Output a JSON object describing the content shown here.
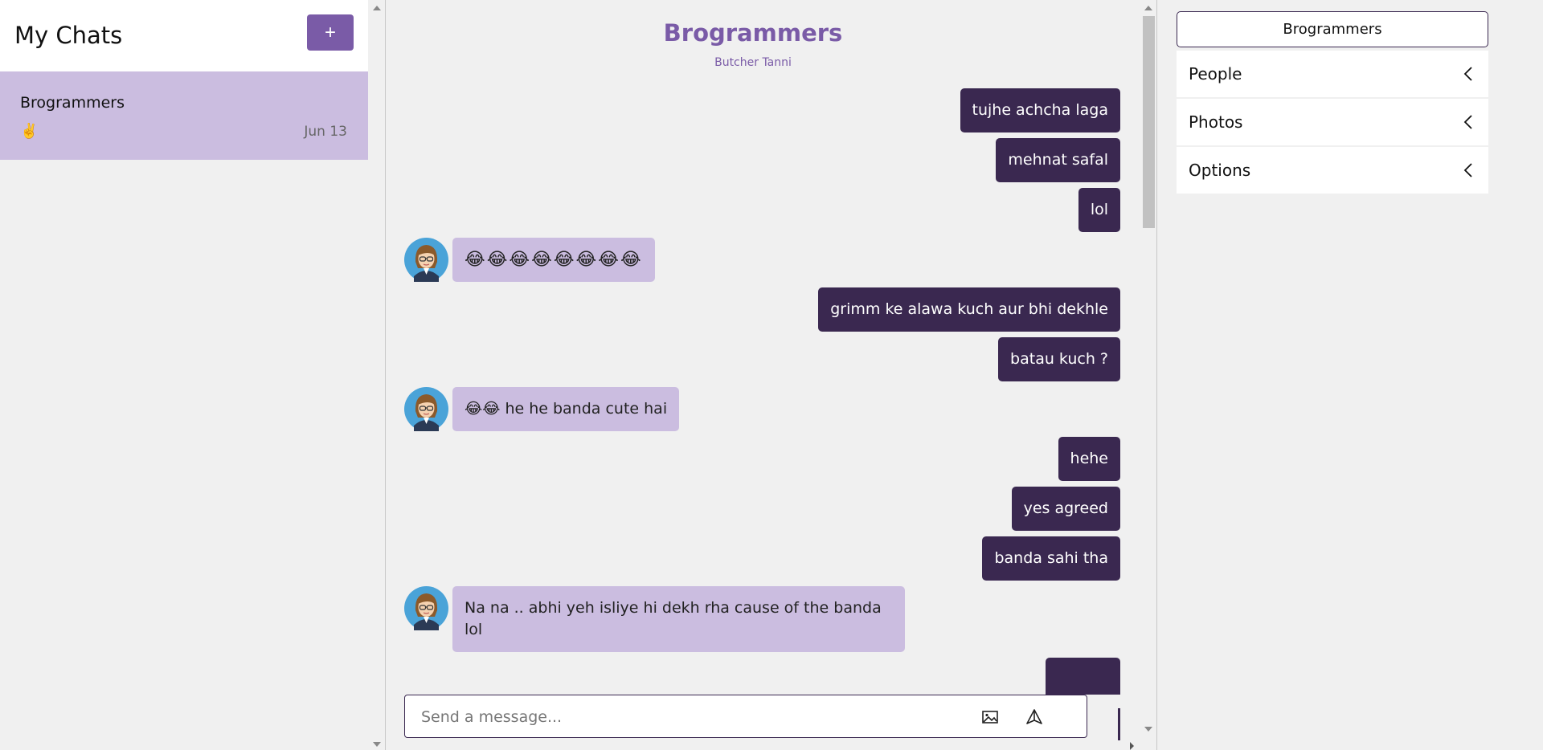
{
  "sidebar": {
    "title": "My Chats",
    "new_chat_label": "+",
    "chats": [
      {
        "name": "Brogrammers",
        "preview": "✌️",
        "date": "Jun 13"
      }
    ]
  },
  "chat": {
    "title": "Brogrammers",
    "subtitle": "Butcher Tanni",
    "messages": [
      {
        "dir": "out",
        "text": "tujhe achcha laga"
      },
      {
        "dir": "out",
        "text": "mehnat safal"
      },
      {
        "dir": "out",
        "text": "lol"
      },
      {
        "dir": "in",
        "text": "😂😂😂😂😂😂😂😂"
      },
      {
        "dir": "out",
        "text": "grimm ke alawa kuch aur bhi dekhle"
      },
      {
        "dir": "out",
        "text": "batau kuch ?"
      },
      {
        "dir": "in",
        "text": "😂😂 he he banda cute hai"
      },
      {
        "dir": "out",
        "text": "hehe"
      },
      {
        "dir": "out",
        "text": "yes agreed"
      },
      {
        "dir": "out",
        "text": "banda sahi tha"
      },
      {
        "dir": "in",
        "text": "Na na .. abhi yeh isliye hi dekh rha cause of the banda lol"
      }
    ],
    "input_placeholder": "Send a message...",
    "input_value": ""
  },
  "details": {
    "group_name": "Brogrammers",
    "sections": [
      {
        "label": "People"
      },
      {
        "label": "Photos"
      },
      {
        "label": "Options"
      }
    ]
  },
  "icons": {
    "new_chat": "plus-icon",
    "image": "image-icon",
    "send": "send-icon",
    "chevron": "chevron-left-icon",
    "avatar": "avatar-woman-icon"
  },
  "colors": {
    "accent": "#7a5ba7",
    "outgoing_bubble": "#3a2850",
    "incoming_bubble": "#cbbde0"
  }
}
